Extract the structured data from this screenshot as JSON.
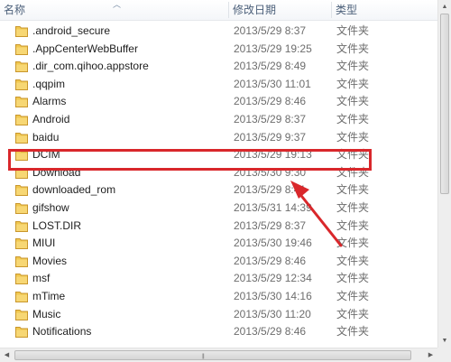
{
  "columns": {
    "name": "名称",
    "date": "修改日期",
    "type": "类型"
  },
  "colors": {
    "highlight": "#d9272b",
    "folder": "#f1c850"
  },
  "icons": {
    "folder": "folder-icon",
    "sort": "sort-up-arrow-icon"
  },
  "rows": [
    {
      "name": ".android_secure",
      "date": "2013/5/29 8:37",
      "type": "文件夹"
    },
    {
      "name": ".AppCenterWebBuffer",
      "date": "2013/5/29 19:25",
      "type": "文件夹"
    },
    {
      "name": ".dir_com.qihoo.appstore",
      "date": "2013/5/29 8:49",
      "type": "文件夹"
    },
    {
      "name": ".qqpim",
      "date": "2013/5/30 11:01",
      "type": "文件夹"
    },
    {
      "name": "Alarms",
      "date": "2013/5/29 8:46",
      "type": "文件夹"
    },
    {
      "name": "Android",
      "date": "2013/5/29 8:37",
      "type": "文件夹"
    },
    {
      "name": "baidu",
      "date": "2013/5/29 9:37",
      "type": "文件夹"
    },
    {
      "name": "DCIM",
      "date": "2013/5/29 19:13",
      "type": "文件夹",
      "highlighted": true
    },
    {
      "name": "Download",
      "date": "2013/5/30 9:30",
      "type": "文件夹"
    },
    {
      "name": "downloaded_rom",
      "date": "2013/5/29 8:41",
      "type": "文件夹"
    },
    {
      "name": "gifshow",
      "date": "2013/5/31 14:39",
      "type": "文件夹"
    },
    {
      "name": "LOST.DIR",
      "date": "2013/5/29 8:37",
      "type": "文件夹"
    },
    {
      "name": "MIUI",
      "date": "2013/5/30 19:46",
      "type": "文件夹"
    },
    {
      "name": "Movies",
      "date": "2013/5/29 8:46",
      "type": "文件夹"
    },
    {
      "name": "msf",
      "date": "2013/5/29 12:34",
      "type": "文件夹"
    },
    {
      "name": "mTime",
      "date": "2013/5/30 14:16",
      "type": "文件夹"
    },
    {
      "name": "Music",
      "date": "2013/5/30 11:20",
      "type": "文件夹"
    },
    {
      "name": "Notifications",
      "date": "2013/5/29 8:46",
      "type": "文件夹"
    }
  ]
}
